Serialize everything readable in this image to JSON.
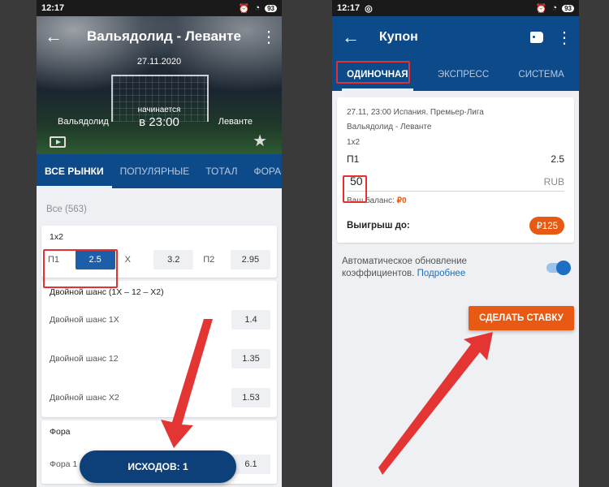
{
  "left": {
    "status": {
      "time": "12:17",
      "battery": "93"
    },
    "match": {
      "title": "Вальядолид - Леванте",
      "date": "27.11.2020",
      "team_home": "Вальядолид",
      "team_away": "Леванте",
      "starts_label": "начинается",
      "starts_time": "в 23:00"
    },
    "tabs": [
      "ВСЕ РЫНКИ",
      "ПОПУЛЯРНЫЕ",
      "ТОТАЛ",
      "ФОРА"
    ],
    "all_count": "Все (563)",
    "market_1x2": {
      "title": "1x2",
      "outcomes": [
        {
          "label": "П1",
          "odds": "2.5"
        },
        {
          "label": "X",
          "odds": "3.2"
        },
        {
          "label": "П2",
          "odds": "2.95"
        }
      ]
    },
    "double_chance": {
      "title": "Двойной шанс (1X – 12 – X2)",
      "rows": [
        {
          "label": "Двойной шанс 1X",
          "odds": "1.4"
        },
        {
          "label": "Двойной шанс 12",
          "odds": "1.35"
        },
        {
          "label": "Двойной шанс X2",
          "odds": "1.53"
        }
      ]
    },
    "handicap": {
      "title": "Фора",
      "row_label": "Фора 1 (+1.5)",
      "row_odds": "6.1"
    },
    "outcomes_button": "ИСХОДОВ: 1"
  },
  "right": {
    "status": {
      "time": "12:17",
      "battery": "93"
    },
    "title": "Купон",
    "tabs": [
      "ОДИНОЧНАЯ",
      "ЭКСПРЕСС",
      "СИСТЕМА"
    ],
    "coupon": {
      "meta": "27.11, 23:00 Испания. Премьер-Лига",
      "event": "Вальядолид - Леванте",
      "market": "1x2",
      "selection": "П1",
      "odds": "2.5",
      "stake": "50",
      "currency": "RUB",
      "balance_label": "Ваш баланс:",
      "balance_value": "₽0",
      "win_label": "Выигрыш до:",
      "win_value": "₽125"
    },
    "auto_update": {
      "text": "Автоматическое обновление коэффициентов.",
      "link": "Подробнее"
    },
    "bet_button": "СДЕЛАТЬ СТАВКУ"
  },
  "colors": {
    "brand_blue": "#0d4a8a",
    "accent_orange": "#e85a13",
    "highlight_red": "#e43030"
  }
}
